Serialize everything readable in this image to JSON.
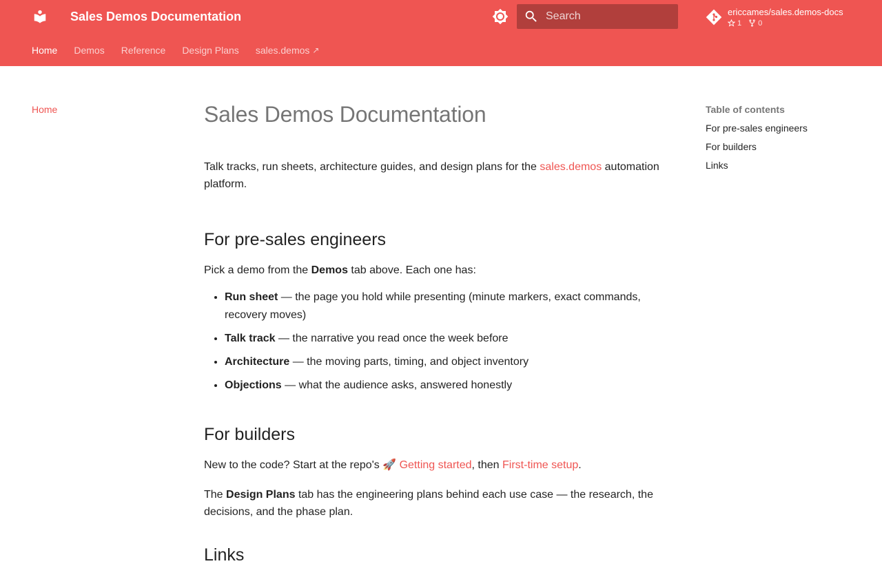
{
  "header": {
    "site_title": "Sales Demos Documentation",
    "search_placeholder": "Search",
    "repo": {
      "name": "ericcames/sales.demos-docs",
      "stars": "1",
      "forks": "0"
    },
    "tabs": [
      {
        "label": "Home",
        "active": true
      },
      {
        "label": "Demos"
      },
      {
        "label": "Reference"
      },
      {
        "label": "Design Plans"
      },
      {
        "label": "sales.demos",
        "external_mark": "↗"
      }
    ]
  },
  "sidebar": {
    "items": [
      {
        "label": "Home"
      }
    ]
  },
  "main": {
    "title": "Sales Demos Documentation",
    "intro": {
      "before": "Talk tracks, run sheets, architecture guides, and design plans for the ",
      "link": "sales.demos",
      "after": " automation platform."
    },
    "presales": {
      "heading": "For pre-sales engineers",
      "pick_before": "Pick a demo from the ",
      "pick_strong": "Demos",
      "pick_after": " tab above. Each one has:",
      "items": [
        {
          "strong": "Run sheet",
          "text": " — the page you hold while presenting (minute markers, exact commands, recovery moves)"
        },
        {
          "strong": "Talk track",
          "text": " — the narrative you read once the week before"
        },
        {
          "strong": "Architecture",
          "text": " — the moving parts, timing, and object inventory"
        },
        {
          "strong": "Objections",
          "text": " — what the audience asks, answered honestly"
        }
      ]
    },
    "builders": {
      "heading": "For builders",
      "start_before": "New to the code? Start at the repo's 🚀 ",
      "link1": "Getting started",
      "mid": ", then ",
      "link2": "First-time setup",
      "end": ".",
      "plans_before": "The ",
      "plans_strong": "Design Plans",
      "plans_after": " tab has the engineering plans behind each use case — the research, the decisions, and the phase plan."
    },
    "links_heading": "Links"
  },
  "toc": {
    "title": "Table of contents",
    "items": [
      "For pre-sales engineers",
      "For builders",
      "Links"
    ]
  },
  "colors": {
    "primary": "#ef5552",
    "search_bg": "rgba(0,0,0,0.26)"
  }
}
